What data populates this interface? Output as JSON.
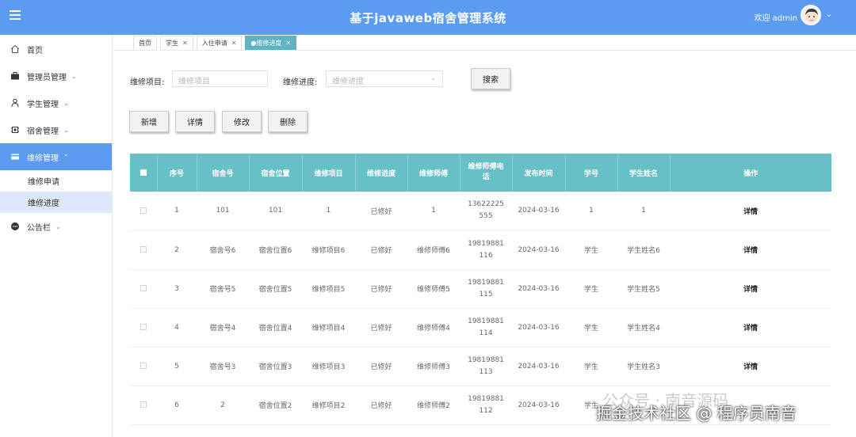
{
  "header": {
    "title": "基于javaweb宿舍管理系统",
    "welcome": "欢迎 admin"
  },
  "sidebar": {
    "items": [
      {
        "label": "首页",
        "icon": "home-icon"
      },
      {
        "label": "管理员管理",
        "icon": "briefcase-icon"
      },
      {
        "label": "学生管理",
        "icon": "person-icon"
      },
      {
        "label": "宿舍管理",
        "icon": "chip-icon"
      },
      {
        "label": "维修管理",
        "icon": "card-icon"
      },
      {
        "label": "公告栏",
        "icon": "chat-icon"
      }
    ],
    "sub_items": [
      "维修申请",
      "维修进度"
    ]
  },
  "tabs": [
    {
      "label": "首页"
    },
    {
      "label": "学生"
    },
    {
      "label": "入住申请"
    },
    {
      "label": "维修进度"
    }
  ],
  "search": {
    "item_label": "维修项目:",
    "item_placeholder": "维修项目",
    "progress_label": "维修进度:",
    "progress_placeholder": "维修进度",
    "search_button": "搜索"
  },
  "actions": {
    "add": "新增",
    "detail": "详情",
    "edit": "修改",
    "delete": "删除"
  },
  "table": {
    "headers": [
      "序号",
      "宿舍号",
      "宿舍位置",
      "维修项目",
      "维修进度",
      "维修师傅",
      "维修师傅电话",
      "发布时间",
      "学号",
      "学生姓名",
      "操作"
    ],
    "rows": [
      [
        "1",
        "101",
        "101",
        "1",
        "已修好",
        "1",
        "13622225555",
        "2024-03-16",
        "1",
        "1",
        "详情"
      ],
      [
        "2",
        "宿舍号6",
        "宿舍位置6",
        "维修项目6",
        "已修好",
        "维修师傅6",
        "19819881116",
        "2024-03-16",
        "学生",
        "学生姓名6",
        "详情"
      ],
      [
        "3",
        "宿舍号5",
        "宿舍位置5",
        "维修项目5",
        "已修好",
        "维修师傅5",
        "19819881115",
        "2024-03-16",
        "学生",
        "学生姓名5",
        "详情"
      ],
      [
        "4",
        "宿舍号4",
        "宿舍位置4",
        "维修项目4",
        "已修好",
        "维修师傅4",
        "19819881114",
        "2024-03-16",
        "学生",
        "学生姓名4",
        "详情"
      ],
      [
        "5",
        "宿舍号3",
        "宿舍位置3",
        "维修项目3",
        "已修好",
        "维修师傅3",
        "19819881113",
        "2024-03-16",
        "学生",
        "学生姓名3",
        "详情"
      ],
      [
        "6",
        "2",
        "宿舍位置2",
        "维修项目2",
        "已修好",
        "维修师傅2",
        "19819881112",
        "2024-03-16",
        "学生",
        "",
        ""
      ]
    ]
  },
  "watermark": {
    "line1": "公众号 · 南音源码",
    "line2": "掘金技术社区 @ 程序员南音"
  },
  "colors": {
    "header_bg": "#5b9cf2",
    "table_header_bg": "#66c0c7",
    "active_tab_bg": "#60b3c5",
    "active_sub_bg": "#dde9fb"
  }
}
